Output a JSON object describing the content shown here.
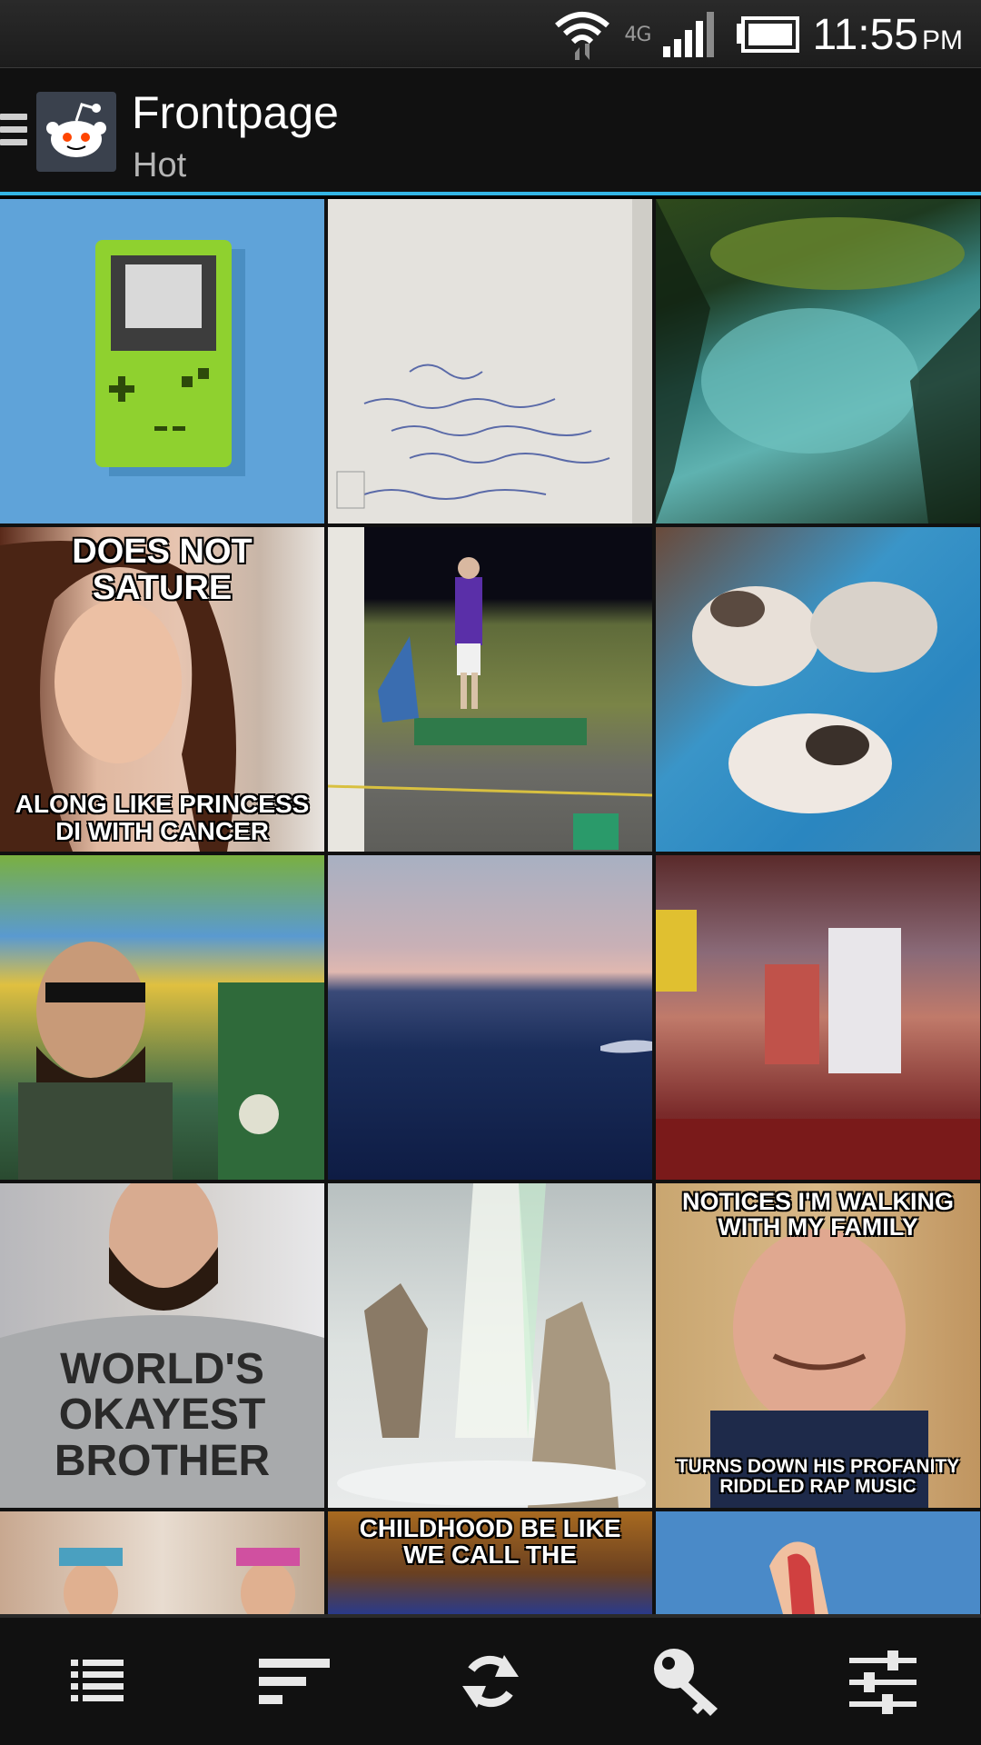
{
  "status_bar": {
    "network": "4G",
    "time": "11:55",
    "ampm": "PM",
    "icons": [
      "wifi-icon",
      "signal-icon",
      "battery-icon"
    ]
  },
  "action_bar": {
    "title": "Frontpage",
    "subtitle": "Hot",
    "accent": "#33b5e5",
    "icons": [
      "drawer-icon",
      "reddit-alien-icon"
    ]
  },
  "grid": {
    "tiles": [
      {
        "id": "gameboy",
        "caption_top": "",
        "caption_bottom": ""
      },
      {
        "id": "handwritten-note",
        "caption_top": "",
        "caption_bottom": ""
      },
      {
        "id": "jungle-pool",
        "caption_top": "",
        "caption_bottom": ""
      },
      {
        "id": "meme-woman",
        "caption_top": "DOES NOT SATURE",
        "caption_bottom": "ALONG LIKE PRINCESS DI WITH CANCER"
      },
      {
        "id": "golf-range",
        "caption_top": "",
        "caption_bottom": ""
      },
      {
        "id": "kittens",
        "caption_top": "",
        "caption_bottom": ""
      },
      {
        "id": "sunglasses-man",
        "caption_top": "",
        "caption_bottom": ""
      },
      {
        "id": "ocean-dusk",
        "caption_top": "",
        "caption_bottom": ""
      },
      {
        "id": "pixel-crowd",
        "caption_top": "",
        "caption_bottom": ""
      },
      {
        "id": "shirt-man",
        "shirt_text": [
          "WORLD'S",
          "OKAYEST",
          "BROTHER"
        ]
      },
      {
        "id": "ice-hall",
        "caption_top": "",
        "caption_bottom": ""
      },
      {
        "id": "good-guy-greg",
        "caption_top": "NOTICES I'M WALKING WITH MY FAMILY",
        "caption_bottom": "TURNS DOWN HIS PROFANITY RIDDLED RAP MUSIC"
      },
      {
        "id": "two-girls",
        "caption_top": "",
        "caption_bottom": ""
      },
      {
        "id": "meme-partial",
        "caption_top": "CHILDHOOD BE LIKE WE CALL THE",
        "caption_bottom": ""
      },
      {
        "id": "hotdog",
        "caption_top": "",
        "caption_bottom": ""
      }
    ]
  },
  "bottom_bar": {
    "buttons": [
      {
        "name": "list-view-button",
        "icon": "list-icon"
      },
      {
        "name": "sort-button",
        "icon": "sort-icon"
      },
      {
        "name": "refresh-button",
        "icon": "refresh-icon"
      },
      {
        "name": "login-button",
        "icon": "key-icon"
      },
      {
        "name": "settings-button",
        "icon": "sliders-icon"
      }
    ]
  }
}
